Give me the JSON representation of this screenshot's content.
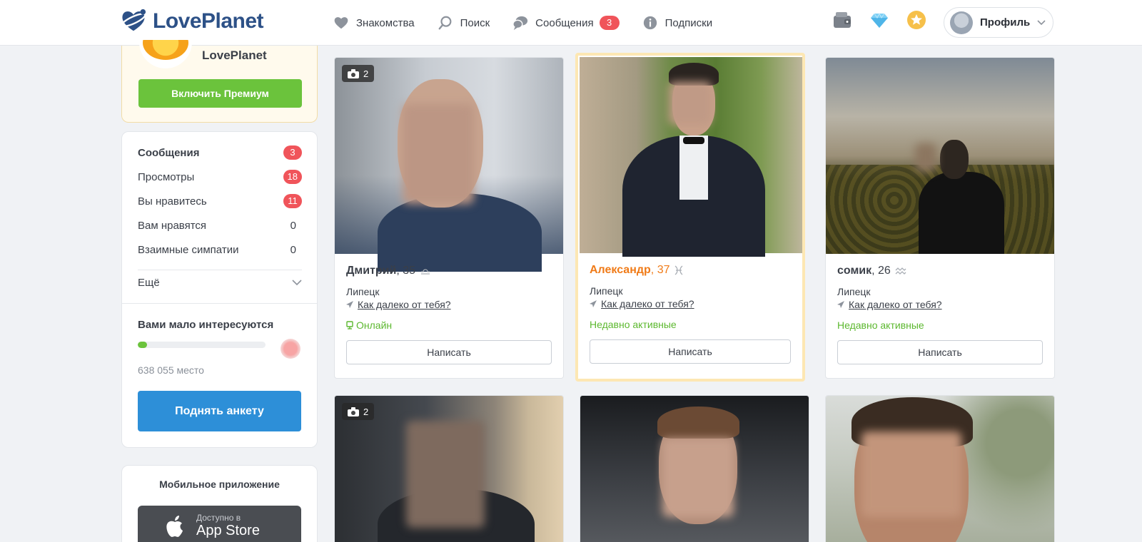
{
  "header": {
    "logo_text": "LovePlanet",
    "nav": [
      {
        "label": "Знакомства",
        "icon": "heart-icon"
      },
      {
        "label": "Поиск",
        "icon": "search-icon"
      },
      {
        "label": "Сообщения",
        "icon": "chat-bubbles-icon",
        "badge": "3"
      },
      {
        "label": "Подписки",
        "icon": "info-icon"
      }
    ],
    "icons": [
      "wallet-icon",
      "diamond-icon",
      "star-coin-icon"
    ],
    "profile_label": "Профиль"
  },
  "premium": {
    "title": "LovePlanet",
    "button": "Включить Премиум"
  },
  "stats": {
    "items": [
      {
        "label": "Сообщения",
        "value": "3",
        "badge": true
      },
      {
        "label": "Просмотры",
        "value": "18",
        "badge": true
      },
      {
        "label": "Вы нравитесь",
        "value": "11",
        "badge": true
      },
      {
        "label": "Вам нравятся",
        "value": "0",
        "badge": false
      },
      {
        "label": "Взаимные симпатии",
        "value": "0",
        "badge": false
      }
    ],
    "more_label": "Ещё",
    "low_interest_title": "Вами мало интересуются",
    "progress_fraction": 0.07,
    "rank_text": "638 055 место",
    "raise_button": "Поднять анкету"
  },
  "app": {
    "title": "Мобильное приложение",
    "store_small": "Доступно в",
    "store_big": "App Store"
  },
  "profiles": [
    {
      "name": "Дмитрий",
      "age": ", 35",
      "zodiac": "libra-icon",
      "city": "Липецк",
      "distance": "Как далеко от тебя?",
      "status": "Онлайн",
      "photos": "2",
      "write": "Написать",
      "highlight": false
    },
    {
      "name": "Александр",
      "age": ", 37",
      "zodiac": "pisces-icon",
      "city": "Липецк",
      "distance": "Как далеко от тебя?",
      "status": "Недавно активные",
      "photos": "",
      "write": "Написать",
      "highlight": true
    },
    {
      "name": "сомик",
      "age": ", 26",
      "zodiac": "aquarius-icon",
      "city": "Липецк",
      "distance": "Как далеко от тебя?",
      "status": "Недавно активные",
      "photos": "",
      "write": "Написать",
      "highlight": false
    },
    {
      "photos": "2"
    },
    {
      "photos": ""
    },
    {
      "photos": ""
    }
  ],
  "colors": {
    "accent_green": "#6bc33c",
    "accent_blue": "#2d8fd8",
    "badge_red": "#f0545a",
    "highlight_name": "#f07b18",
    "logo_blue": "#2d5187"
  }
}
